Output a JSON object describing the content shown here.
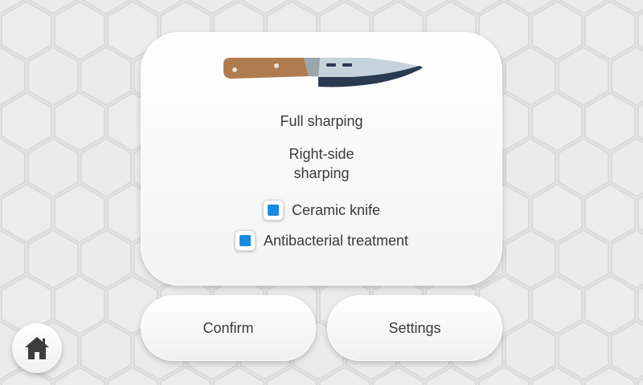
{
  "options": {
    "full_sharpening": "Full sharping",
    "right_side_line1": "Right-side",
    "right_side_line2": "sharping",
    "ceramic_knife": {
      "label": "Ceramic knife",
      "checked": true
    },
    "antibacterial": {
      "label": "Antibacterial treatment",
      "checked": true
    }
  },
  "buttons": {
    "confirm": "Confirm",
    "settings": "Settings"
  },
  "icons": {
    "knife": "knife-icon",
    "home": "home-icon"
  },
  "colors": {
    "accent": "#1a8be0",
    "handle": "#b07c4f",
    "blade": "#c5d3dc",
    "blade_edge": "#2a3a50",
    "text": "#3a3a3a",
    "background": "#e6e6e6"
  }
}
